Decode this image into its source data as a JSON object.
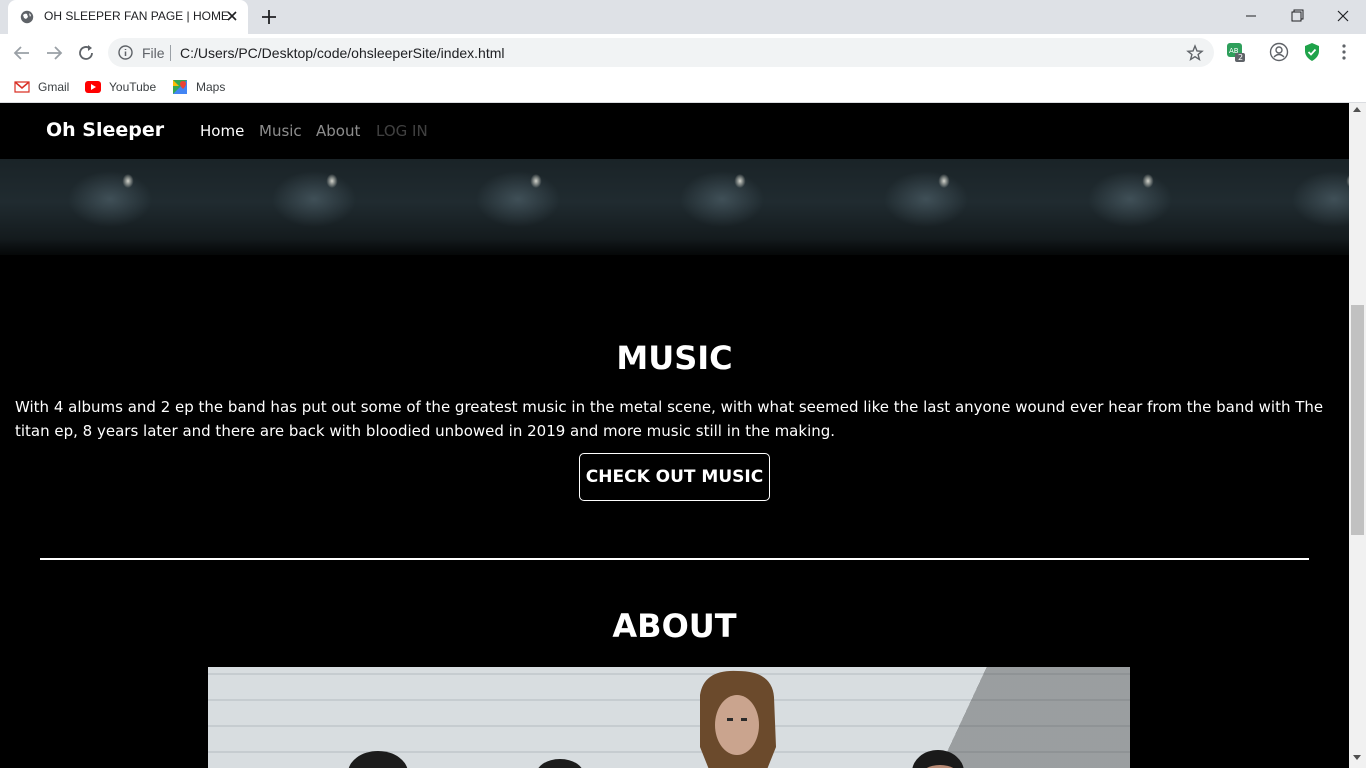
{
  "browser": {
    "tab_title": "OH SLEEPER FAN PAGE | HOME",
    "omnibox_scheme": "File",
    "omnibox_url": "C:/Users/PC/Desktop/code/ohsleeperSite/index.html",
    "bookmarks": [
      "Gmail",
      "YouTube",
      "Maps"
    ],
    "extension_badge": "2"
  },
  "navbar": {
    "brand": "Oh Sleeper",
    "links": [
      "Home",
      "Music",
      "About",
      "LOG IN"
    ]
  },
  "music": {
    "title": "MUSIC",
    "text": "With 4 albums and 2 ep the band has put out some of the greatest music in the metal scene, with what seemed like the last anyone wound ever hear from the band with The titan ep, 8 years later and there are back with bloodied unbowed in 2019 and more music still in the making.",
    "button": "CHECK OUT MUSIC"
  },
  "about": {
    "title": "ABOUT"
  },
  "colors": {
    "page_bg": "#000000",
    "text": "#ffffff",
    "tabstrip": "#dee1e6"
  }
}
